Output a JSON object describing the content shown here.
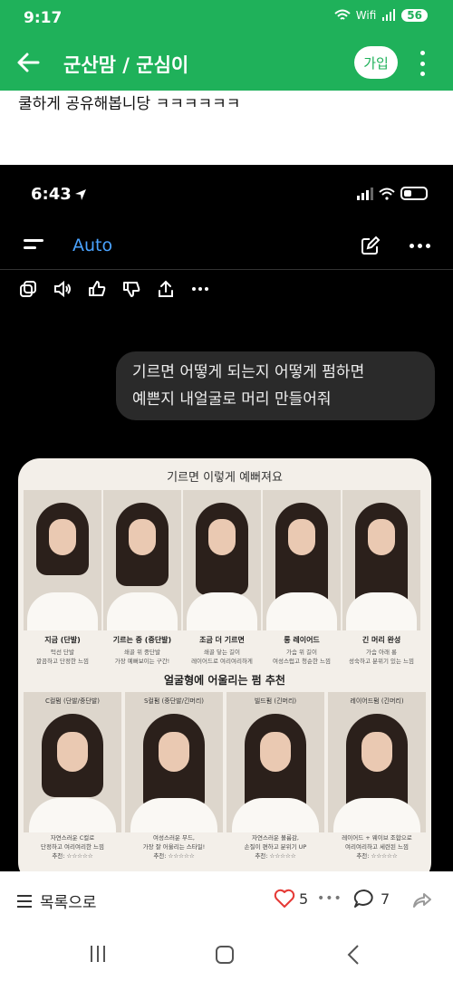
{
  "status_bar": {
    "time": "9:17",
    "network": "Wifi",
    "battery": "56"
  },
  "app_bar": {
    "title": "군산맘 / 군심이",
    "join_label": "가입"
  },
  "post": {
    "text": "쿨하게 공유해봅니당 ㅋㅋㅋㅋㅋㅋ"
  },
  "embedded": {
    "time": "6:43",
    "mode_label": "Auto",
    "bubble_lines": [
      "기르면 어떻게 되는지 어떻게 펌하면",
      "예쁜지 내얼굴로 머리 만들어줘"
    ],
    "card": {
      "title": "기르면 이렇게 예뻐져요",
      "stages": [
        {
          "title": "지금 (단발)",
          "desc": [
            "턱선 단발",
            "깔끔하고 단정한 느낌"
          ]
        },
        {
          "title": "기르는 중 (중단발)",
          "desc": [
            "쇄골 위 중단발",
            "가장 예뻐보이는 구간!"
          ]
        },
        {
          "title": "조금 더 기르면",
          "desc": [
            "쇄골 닿는 길이",
            "레이어드로 여리여리하게"
          ]
        },
        {
          "title": "롱 레이어드",
          "desc": [
            "가슴 위 길이",
            "여성스럽고 청순한 느낌"
          ]
        },
        {
          "title": "긴 머리 완성",
          "desc": [
            "가슴 아래 롱",
            "성숙하고 분위기 있는 느낌"
          ]
        }
      ],
      "perm_title": "얼굴형에 어울리는 펌 추천",
      "perms": [
        {
          "label": "C컬펌 (단발/중단발)",
          "desc": [
            "자연스러운 C컬로",
            "단정하고 여리여리한 느낌",
            "추천: ☆☆☆☆☆"
          ]
        },
        {
          "label": "S컬펌 (중단발/긴머리)",
          "desc": [
            "여성스러운 무드,",
            "가장 잘 어울리는 스타일!",
            "추천: ☆☆☆☆☆"
          ]
        },
        {
          "label": "빌드펌 (긴머리)",
          "desc": [
            "자연스러운 볼륨감,",
            "손질이 편하고 분위기 UP",
            "추천: ☆☆☆☆☆"
          ]
        },
        {
          "label": "레이어드펌 (긴머리)",
          "desc": [
            "레이어드 + 웨이브 조합으로",
            "여리여리하고 세련된 느낌",
            "추천: ☆☆☆☆☆"
          ]
        }
      ]
    }
  },
  "bottom_bar": {
    "list_label": "목록으로",
    "likes": "5",
    "comments": "7"
  },
  "colors": {
    "brand_green": "#1fb15a",
    "like_red": "#e53935",
    "link_blue": "#4aa3ff"
  }
}
